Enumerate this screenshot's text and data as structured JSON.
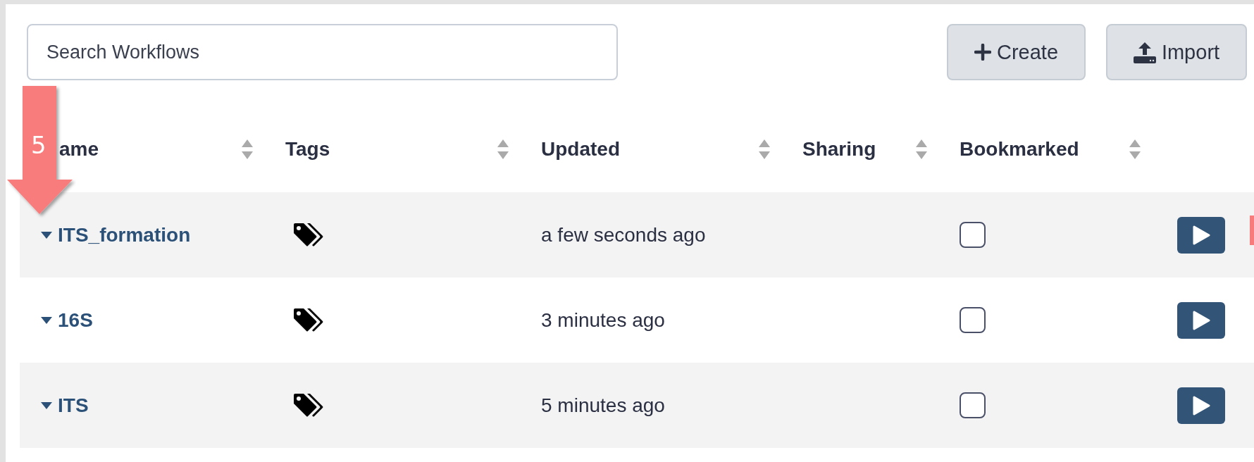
{
  "search": {
    "placeholder": "Search Workflows"
  },
  "buttons": [
    {
      "kind": "create",
      "label": "Create"
    },
    {
      "kind": "import",
      "label": "Import"
    }
  ],
  "columns": [
    {
      "label": "ame"
    },
    {
      "label": "Tags"
    },
    {
      "label": "Updated"
    },
    {
      "label": "Sharing"
    },
    {
      "label": "Bookmarked"
    }
  ],
  "rows": [
    {
      "name": "ITS_formation",
      "updated": "a few seconds ago",
      "bookmarked": false
    },
    {
      "name": "16S",
      "updated": "3 minutes ago",
      "bookmarked": false
    },
    {
      "name": "ITS",
      "updated": "5 minutes ago",
      "bookmarked": false
    }
  ],
  "callout": {
    "number": "5"
  }
}
